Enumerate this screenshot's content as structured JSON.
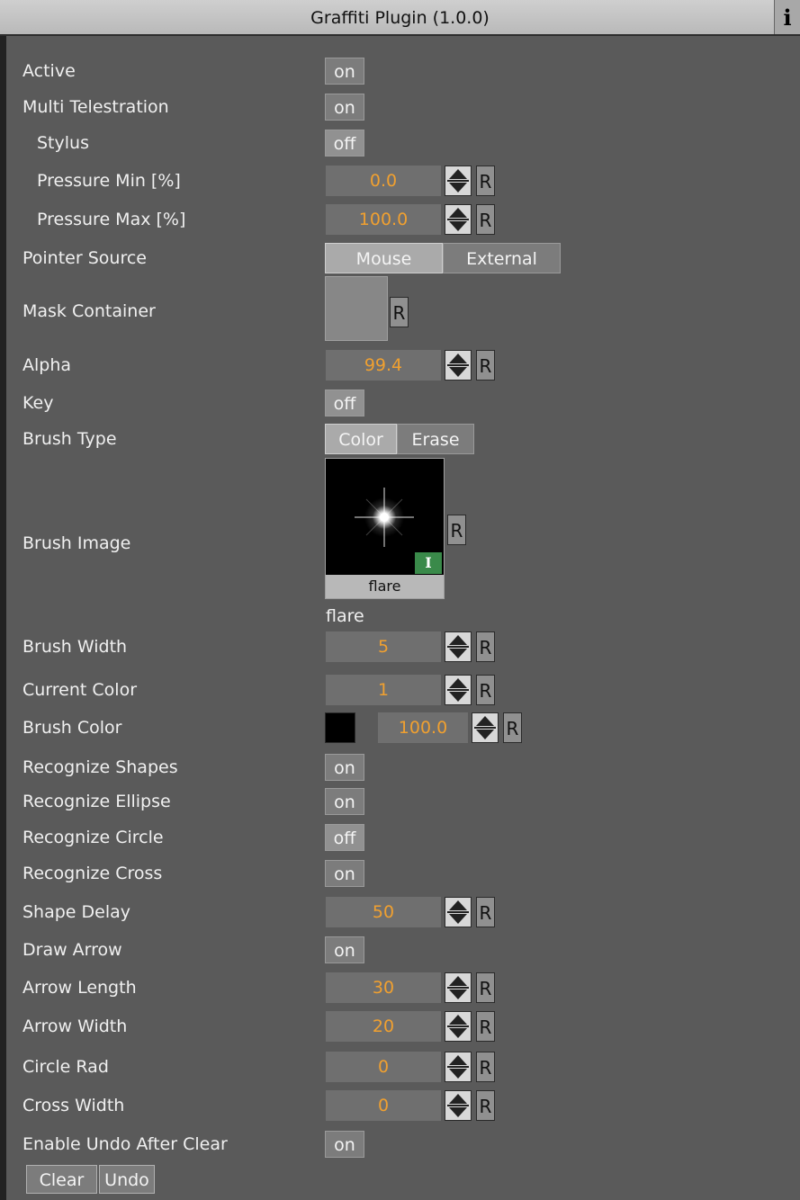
{
  "window": {
    "title": "Graffiti Plugin (1.0.0)",
    "info_glyph": "i"
  },
  "fields": {
    "active": {
      "label": "Active",
      "value": "on"
    },
    "multi_telestration": {
      "label": "Multi Telestration",
      "value": "on"
    },
    "stylus": {
      "label": "Stylus",
      "value": "off"
    },
    "pressure_min": {
      "label": "Pressure Min [%]",
      "value": "0.0"
    },
    "pressure_max": {
      "label": "Pressure Max [%]",
      "value": "100.0"
    },
    "pointer_source": {
      "label": "Pointer Source",
      "options": [
        "Mouse",
        "External"
      ],
      "selected": "Mouse"
    },
    "mask_container": {
      "label": "Mask Container"
    },
    "alpha": {
      "label": "Alpha",
      "value": "99.4"
    },
    "key": {
      "label": "Key",
      "value": "off"
    },
    "brush_type": {
      "label": "Brush Type",
      "options": [
        "Color",
        "Erase"
      ],
      "selected": "Color"
    },
    "brush_image": {
      "label": "Brush Image",
      "thumb_label": "flare",
      "name": "flare",
      "badge": "I"
    },
    "brush_width": {
      "label": "Brush Width",
      "value": "5"
    },
    "current_color": {
      "label": "Current Color",
      "value": "1"
    },
    "brush_color": {
      "label": "Brush Color",
      "swatch": "#000000",
      "value": "100.0"
    },
    "recognize_shapes": {
      "label": "Recognize Shapes",
      "value": "on"
    },
    "recognize_ellipse": {
      "label": "Recognize Ellipse",
      "value": "on"
    },
    "recognize_circle": {
      "label": "Recognize Circle",
      "value": "off"
    },
    "recognize_cross": {
      "label": "Recognize Cross",
      "value": "on"
    },
    "shape_delay": {
      "label": "Shape Delay",
      "value": "50"
    },
    "draw_arrow": {
      "label": "Draw Arrow",
      "value": "on"
    },
    "arrow_length": {
      "label": "Arrow Length",
      "value": "30"
    },
    "arrow_width": {
      "label": "Arrow Width",
      "value": "20"
    },
    "circle_rad": {
      "label": "Circle Rad",
      "value": "0"
    },
    "cross_width": {
      "label": "Cross Width",
      "value": "0"
    },
    "enable_undo_after_clear": {
      "label": "Enable Undo After Clear",
      "value": "on"
    }
  },
  "reset_label": "R",
  "buttons": {
    "clear": "Clear",
    "undo": "Undo"
  },
  "colors": {
    "value_text": "#f0a030",
    "panel_bg": "#5a5a5a"
  }
}
